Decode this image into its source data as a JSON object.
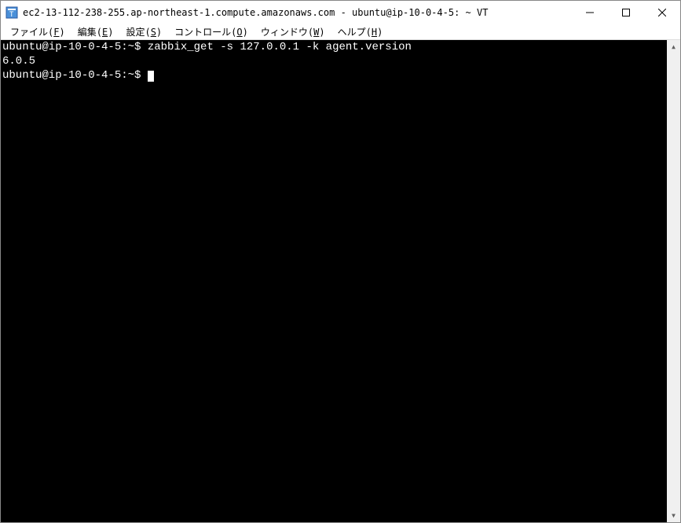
{
  "window": {
    "title": "ec2-13-112-238-255.ap-northeast-1.compute.amazonaws.com - ubuntu@ip-10-0-4-5: ~ VT"
  },
  "menu": {
    "file": "ファイル",
    "file_u": "F",
    "edit": "編集",
    "edit_u": "E",
    "setup": "設定",
    "setup_u": "S",
    "control": "コントロール",
    "control_u": "O",
    "window": "ウィンドウ",
    "window_u": "W",
    "help": "ヘルプ",
    "help_u": "H"
  },
  "terminal": {
    "line1_prompt": "ubuntu@ip-10-0-4-5:~$",
    "line1_cmd": " zabbix_get -s 127.0.0.1 -k agent.version",
    "line2": "6.0.5",
    "line3_prompt": "ubuntu@ip-10-0-4-5:~$ "
  },
  "scroll": {
    "up": "▲",
    "down": "▼"
  }
}
